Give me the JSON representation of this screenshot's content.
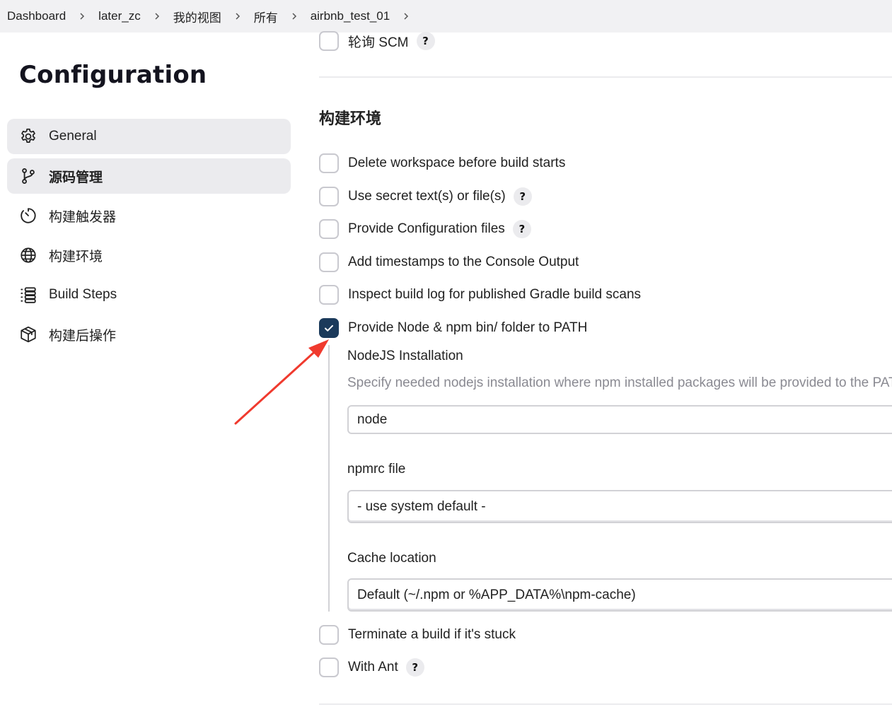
{
  "breadcrumb": [
    "Dashboard",
    "later_zc",
    "我的视图",
    "所有",
    "airbnb_test_01"
  ],
  "page_title": "Configuration",
  "sidebar": {
    "items": [
      {
        "label": "General",
        "icon": "gear-icon"
      },
      {
        "label": "源码管理",
        "icon": "git-branch-icon"
      },
      {
        "label": "构建触发器",
        "icon": "timer-icon"
      },
      {
        "label": "构建环境",
        "icon": "globe-icon"
      },
      {
        "label": "Build Steps",
        "icon": "list-icon"
      },
      {
        "label": "构建后操作",
        "icon": "package-icon"
      }
    ]
  },
  "poll_scm": {
    "label": "轮询 SCM",
    "checked": false
  },
  "build_env": {
    "title": "构建环境",
    "options": [
      {
        "label": "Delete workspace before build starts",
        "checked": false
      },
      {
        "label": "Use secret text(s) or file(s)",
        "checked": false
      },
      {
        "label": "Provide Configuration files",
        "checked": false
      },
      {
        "label": "Add timestamps to the Console Output",
        "checked": false
      },
      {
        "label": "Inspect build log for published Gradle build scans",
        "checked": false
      },
      {
        "label": "Provide Node & npm bin/ folder to PATH",
        "checked": true
      }
    ],
    "nodejs": {
      "installation_label": "NodeJS Installation",
      "installation_desc": "Specify needed nodejs installation where npm installed packages will be provided to the PATH",
      "installation_value": "node",
      "npmrc_label": "npmrc file",
      "npmrc_value": "- use system default -",
      "cache_label": "Cache location",
      "cache_value": "Default (~/.npm or %APP_DATA%\\npm-cache)"
    },
    "more_options": [
      {
        "label": "Terminate a build if it's stuck",
        "checked": false
      },
      {
        "label": "With Ant",
        "checked": false
      }
    ]
  },
  "help_symbol": "?",
  "colors": {
    "accent": "#1b3a5b",
    "annotation_arrow": "#f03a2e"
  }
}
